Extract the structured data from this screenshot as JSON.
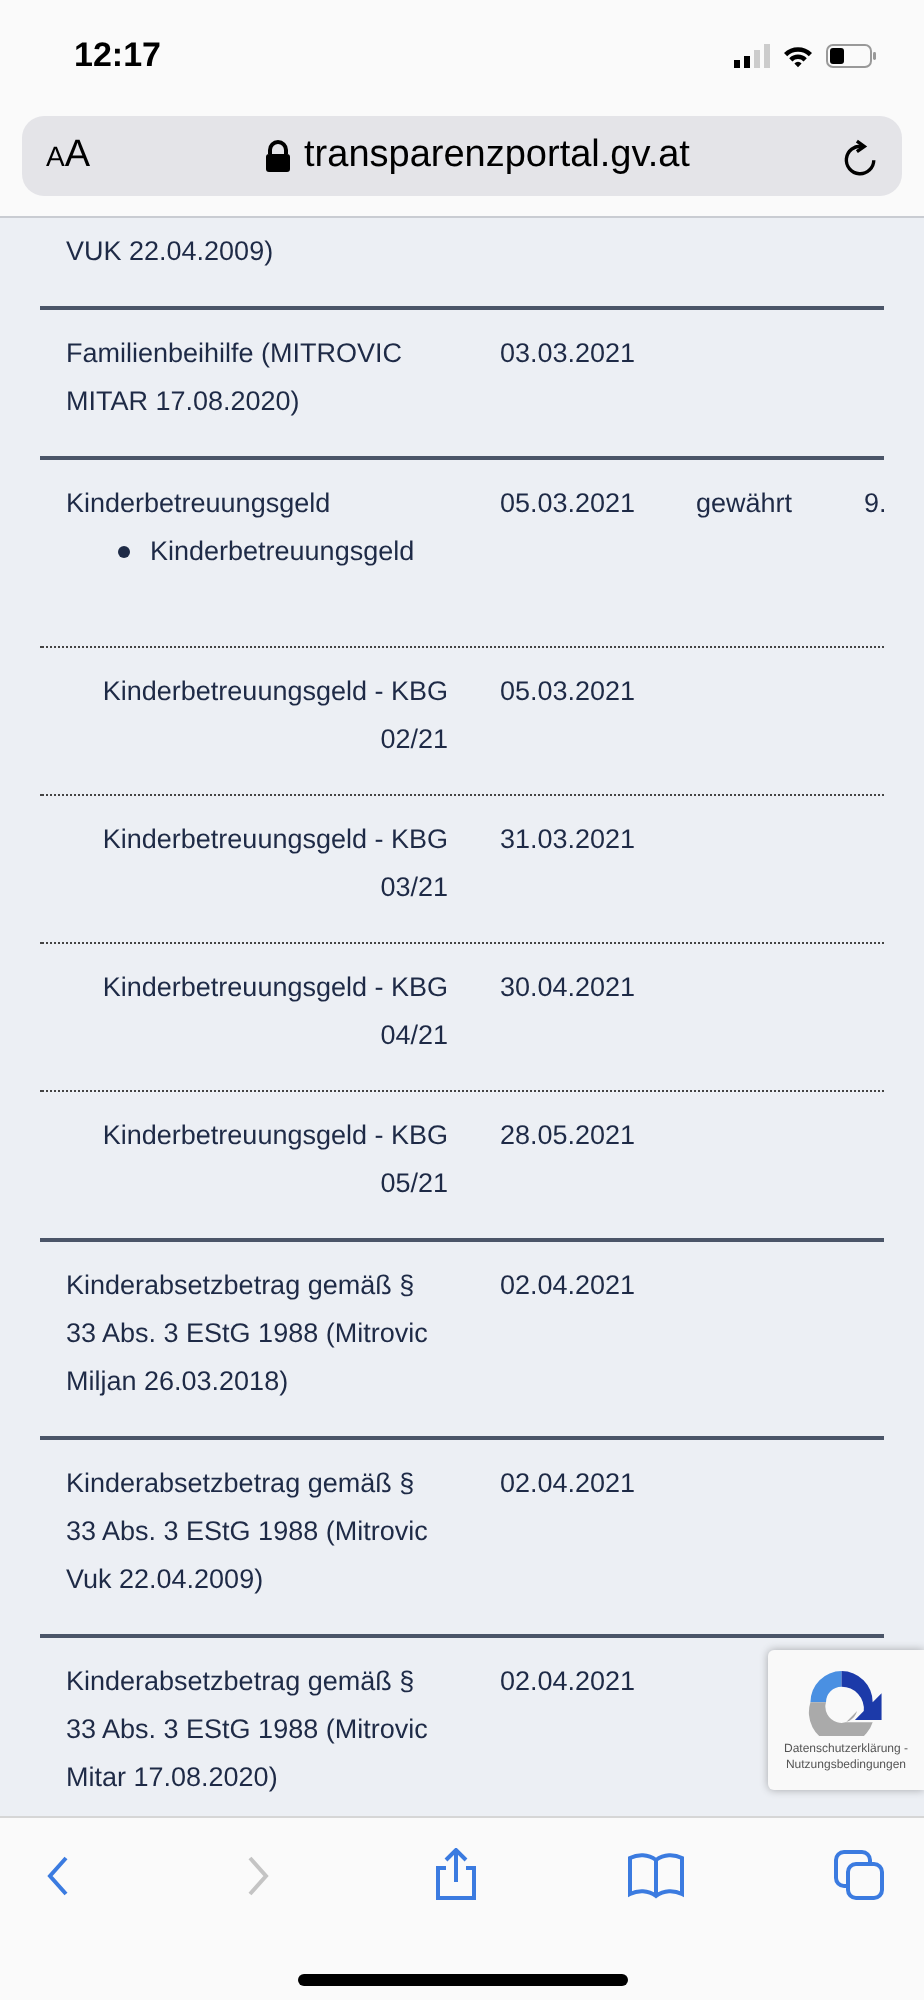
{
  "status_bar": {
    "time": "12:17"
  },
  "address_bar": {
    "text_size_button": "AA",
    "url": "transparenzportal.gv.at"
  },
  "rows": [
    {
      "kind": "main",
      "name": "VUK 22.04.2009)"
    },
    {
      "kind": "main",
      "name": "Familienbeihilfe (MITROVIC MITAR 17.08.2020)",
      "date": "03.03.2021"
    },
    {
      "kind": "main",
      "name": "Kinderbetreuungsgeld",
      "date": "05.03.2021",
      "status": "gewährt",
      "amount": "9.",
      "bullets": [
        "Kinderbetreuungsgeld"
      ]
    },
    {
      "kind": "sub",
      "name": "Kinderbetreuungsgeld - KBG 02/21",
      "date": "05.03.2021"
    },
    {
      "kind": "sub",
      "name": "Kinderbetreuungsgeld - KBG 03/21",
      "date": "31.03.2021"
    },
    {
      "kind": "sub",
      "name": "Kinderbetreuungsgeld - KBG 04/21",
      "date": "30.04.2021"
    },
    {
      "kind": "sub",
      "name": "Kinderbetreuungsgeld - KBG 05/21",
      "date": "28.05.2021"
    },
    {
      "kind": "main",
      "name": "Kinderabsetzbetrag gemäß § 33 Abs. 3 EStG 1988 (Mitrovic Miljan 26.03.2018)",
      "date": "02.04.2021"
    },
    {
      "kind": "main",
      "name": "Kinderabsetzbetrag gemäß § 33 Abs. 3 EStG 1988 (Mitrovic Vuk 22.04.2009)",
      "date": "02.04.2021"
    },
    {
      "kind": "main",
      "name": "Kinderabsetzbetrag gemäß § 33 Abs. 3 EStG 1988 (Mitrovic Mitar 17.08.2020)",
      "date": "02.04.2021"
    }
  ],
  "captcha_badge": {
    "links": "Datenschutzerklärung - Nutzungsbedingungen"
  },
  "toolbar": {
    "back_disabled": false,
    "forward_disabled": true
  }
}
